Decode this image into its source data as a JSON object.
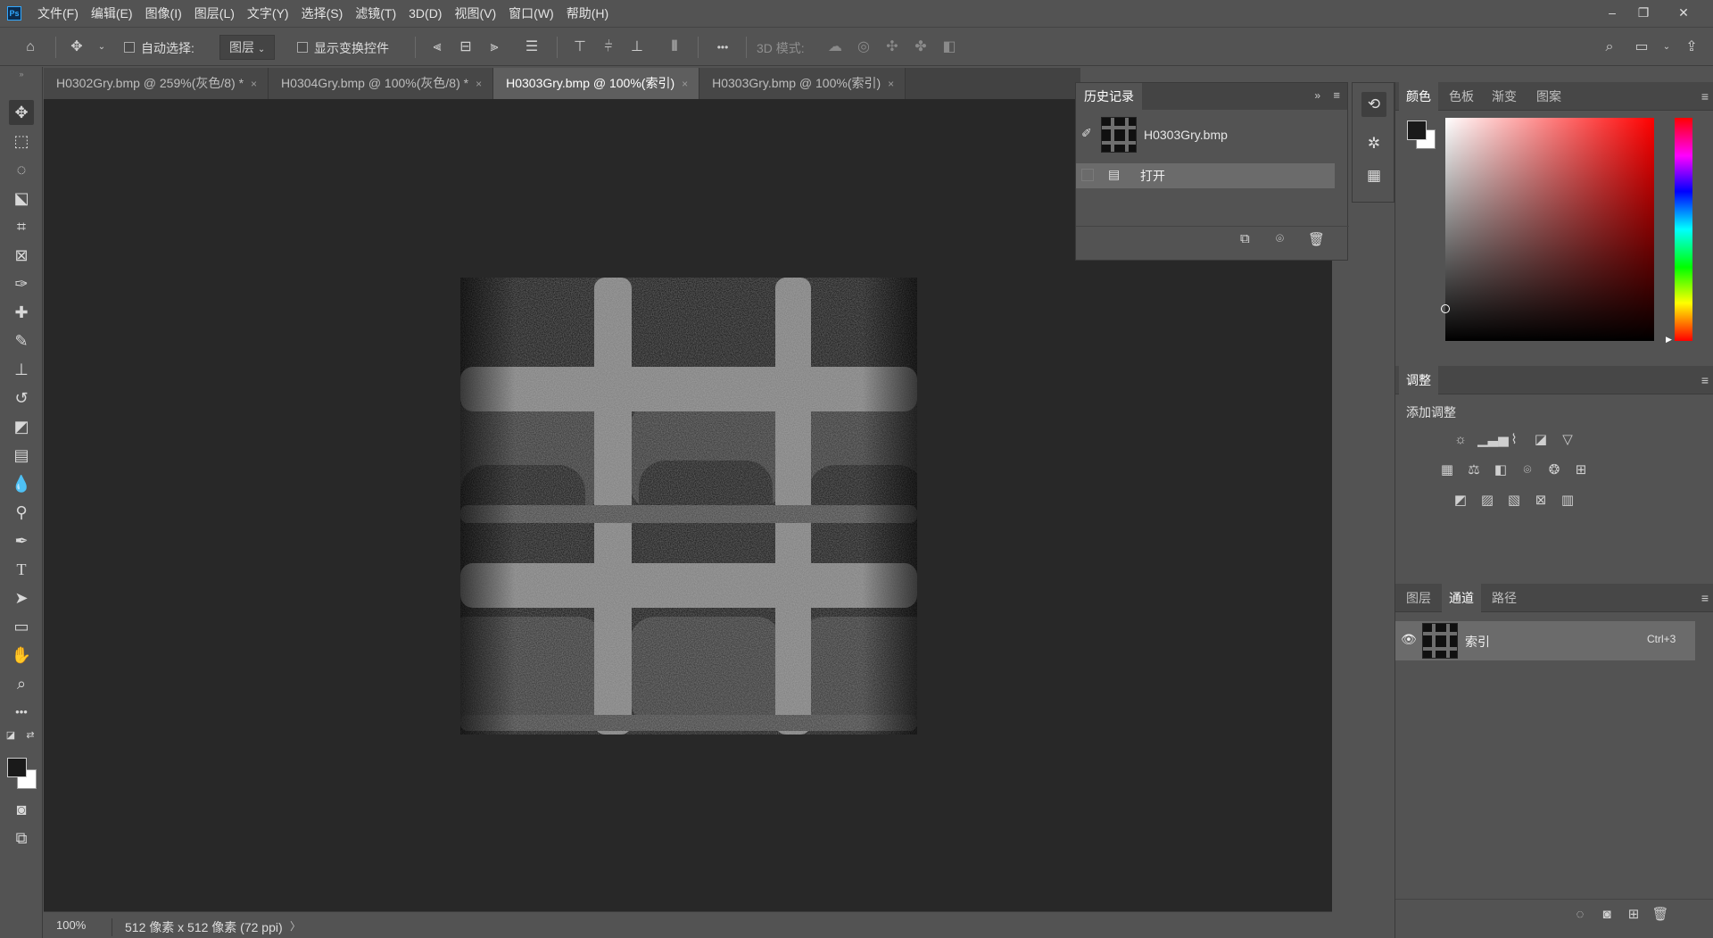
{
  "app": {
    "logo": "Ps"
  },
  "menu": [
    "文件(F)",
    "编辑(E)",
    "图像(I)",
    "图层(L)",
    "文字(Y)",
    "选择(S)",
    "滤镜(T)",
    "3D(D)",
    "视图(V)",
    "窗口(W)",
    "帮助(H)"
  ],
  "window_controls": {
    "minimize": "–",
    "restore": "❐",
    "close": "✕"
  },
  "options_bar": {
    "auto_select_label": "自动选择:",
    "auto_select_value": "图层",
    "show_transform_label": "显示变换控件",
    "mode_3d_label": "3D 模式:",
    "more": "•••"
  },
  "tabs": [
    {
      "label": "H0302Gry.bmp @ 259%(灰色/8) *",
      "close": "×"
    },
    {
      "label": "H0304Gry.bmp @ 100%(灰色/8) *",
      "close": "×"
    },
    {
      "label": "H0303Gry.bmp @ 100%(索引)",
      "close": "×"
    },
    {
      "label": "H0303Gry.bmp @ 100%(索引)",
      "close": "×"
    }
  ],
  "active_tab_index": 2,
  "history_panel": {
    "tab": "历史记录",
    "snapshot_name": "H0303Gry.bmp",
    "steps": [
      "打开"
    ]
  },
  "color_panel": {
    "tabs": [
      "颜色",
      "色板",
      "渐变",
      "图案"
    ],
    "active": "颜色",
    "foreground": "#1a1a1a",
    "background": "#ffffff",
    "hue_color": "#ff0000"
  },
  "adjustments_panel": {
    "tab": "调整",
    "add_label": "添加调整"
  },
  "channels_panel": {
    "tabs": [
      "图层",
      "通道",
      "路径"
    ],
    "active": "通道",
    "channels": [
      {
        "name": "索引",
        "shortcut": "Ctrl+3"
      }
    ]
  },
  "status": {
    "zoom": "100%",
    "doc_size": "512 像素 x 512 像素 (72 ppi)",
    "arrow": "〉"
  }
}
